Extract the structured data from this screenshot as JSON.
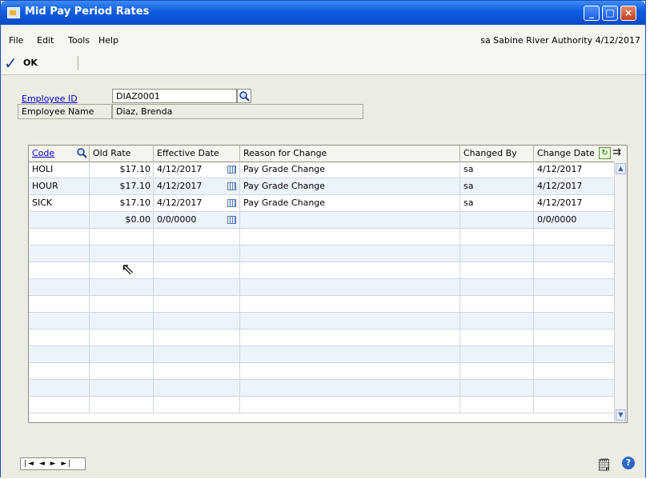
{
  "window": {
    "title": "Mid Pay Period Rates"
  },
  "menu": {
    "items": [
      "File",
      "Edit",
      "Tools",
      "Help"
    ],
    "status": "sa  Sabine River Authority  4/12/2017"
  },
  "toolbar": {
    "ok_label": "OK"
  },
  "form": {
    "employee_id_label": "Employee ID",
    "employee_id_value": "DIAZ0001",
    "employee_name_label": "Employee Name",
    "employee_name_value": "Diaz, Brenda"
  },
  "grid": {
    "columns": [
      "Code",
      "Old Rate",
      "Effective Date",
      "Reason for Change",
      "Changed By",
      "Change Date"
    ],
    "rows": [
      [
        "HOLI",
        "$17.10",
        "4/12/2017",
        "Pay Grade Change",
        "sa",
        "4/12/2017"
      ],
      [
        "HOUR",
        "$17.10",
        "4/12/2017",
        "Pay Grade Change",
        "sa",
        "4/12/2017"
      ],
      [
        "SICK",
        "$17.10",
        "4/12/2017",
        "Pay Grade Change",
        "sa",
        "4/12/2017"
      ],
      [
        "",
        "$0.00",
        "0/0/0000",
        "",
        "",
        "0/0/0000"
      ]
    ]
  },
  "navigation": {
    "glyphs": "|◄ ◄ ► ►|"
  },
  "icons": {
    "app": "app-icon",
    "minimize": "minimize-icon",
    "maximize": "maximize-icon",
    "close": "close-icon",
    "check": "checkmark-icon",
    "lookup": "magnifier-icon",
    "calendar": "calendar-icon",
    "note": "note-icon",
    "help": "help-icon"
  }
}
